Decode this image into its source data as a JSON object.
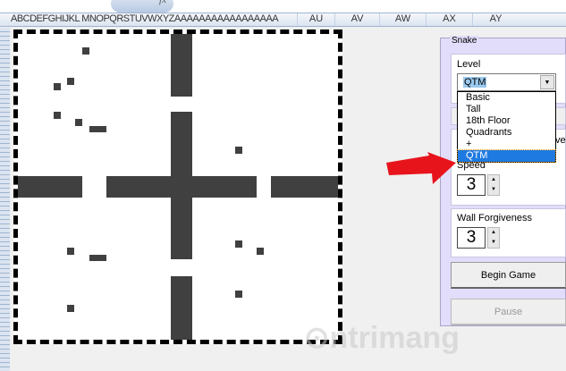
{
  "formula_bar": {
    "fx_label": "fx"
  },
  "columns": {
    "narrow": "ABCDEFGHIJKL MNOPQRSTUVWXYZAAAAAAAAAAAAAAAAA",
    "wide": [
      "AU",
      "AV",
      "AW",
      "AX",
      "AY"
    ]
  },
  "panel": {
    "group_title": "Snake",
    "level_label": "Level",
    "level_value": "QTM",
    "level_options": [
      "Basic",
      "Tall",
      "18th Floor",
      "Quadrants",
      "+",
      "QTM"
    ],
    "hidden_button_fragment": "vel",
    "speed_label": "Speed",
    "speed_value": "3",
    "wall_label": "Wall Forgiveness",
    "wall_value": "3",
    "begin_label": "Begin Game",
    "pause_label": "Pause"
  },
  "watermark": "Quantrimang",
  "colors": {
    "panel": "#e2ddfa",
    "selection": "#1e7ae0",
    "wall": "#404040",
    "arrow": "#e8141c"
  }
}
